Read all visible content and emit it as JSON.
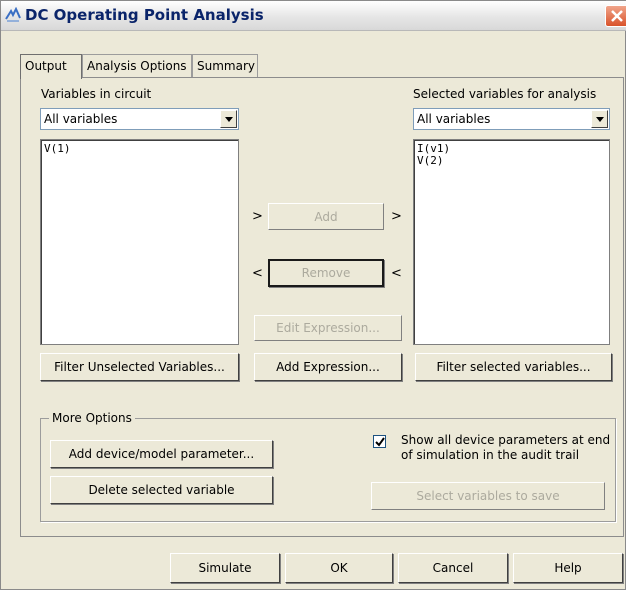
{
  "window": {
    "title": "DC Operating Point Analysis"
  },
  "tabs": [
    "Output",
    "Analysis Options",
    "Summary"
  ],
  "left_panel": {
    "label": "Variables in circuit",
    "filter_value": "All variables",
    "items": [
      "V(1)"
    ],
    "filter_button": "Filter Unselected Variables..."
  },
  "right_panel": {
    "label": "Selected variables for analysis",
    "filter_value": "All variables",
    "items": [
      "I(v1)",
      "V(2)"
    ],
    "filter_button": "Filter selected variables..."
  },
  "middle": {
    "add_label": "Add",
    "remove_label": "Remove",
    "edit_expression_label": "Edit Expression...",
    "add_expression_label": "Add Expression...",
    "arrow_right": ">",
    "arrow_left": "<"
  },
  "more_options": {
    "title": "More Options",
    "add_param_label": "Add device/model parameter...",
    "delete_var_label": "Delete selected variable",
    "show_params_line1": "Show all device parameters at end",
    "show_params_line2": "of simulation in the audit trail",
    "show_params_checked": true,
    "select_to_save_label": "Select variables to save"
  },
  "footer": {
    "simulate": "Simulate",
    "ok": "OK",
    "cancel": "Cancel",
    "help": "Help"
  }
}
